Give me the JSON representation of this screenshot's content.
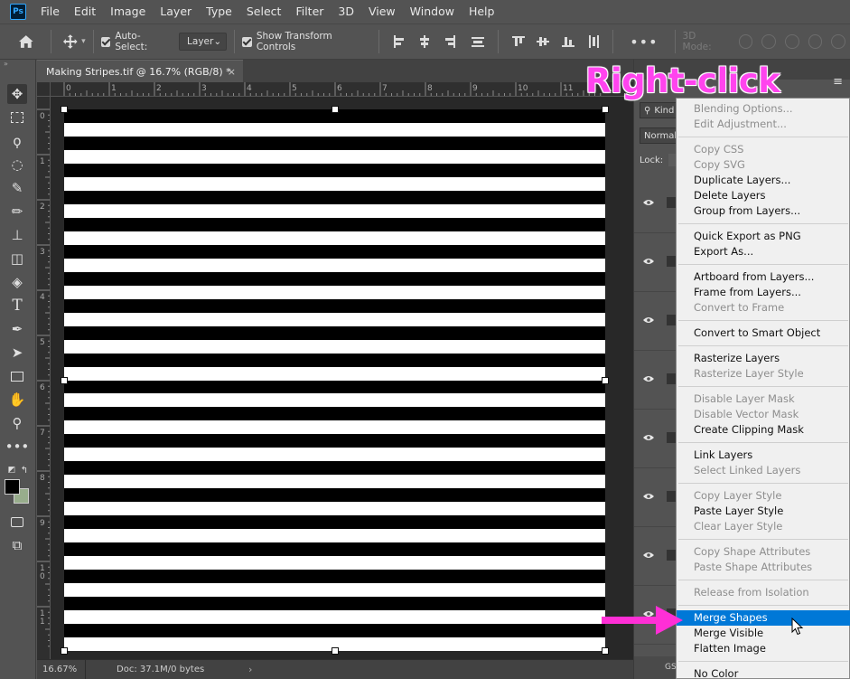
{
  "app": {
    "logo": "Ps"
  },
  "menubar": [
    "File",
    "Edit",
    "Image",
    "Layer",
    "Type",
    "Select",
    "Filter",
    "3D",
    "View",
    "Window",
    "Help"
  ],
  "options": {
    "auto_select_label": "Auto-Select:",
    "auto_select_value": "Layer",
    "show_transform_label": "Show Transform Controls",
    "more_label": "•••",
    "mode_3d_label": "3D Mode:"
  },
  "document": {
    "tab_title": "Making Stripes.tif @ 16.7% (RGB/8) *",
    "close_glyph": "×",
    "stripes": 20,
    "stripe_dark": "#000000",
    "stripe_light": "#ffffff"
  },
  "rulers": {
    "top": [
      "0",
      "1",
      "2",
      "3",
      "4",
      "5",
      "6",
      "7",
      "8",
      "9",
      "10",
      "11"
    ],
    "left": [
      "0",
      "1",
      "2",
      "3",
      "4",
      "5",
      "6",
      "7",
      "8",
      "9",
      "10",
      "11"
    ]
  },
  "status": {
    "zoom": "16.67%",
    "doc_info": "Doc: 37.1M/0 bytes",
    "caret": "›"
  },
  "colors": {
    "foreground": "#000000",
    "background": "#98ad8c",
    "highlight": "#0078d7",
    "annotation": "#ff44ee"
  },
  "panel": {
    "kind_label": "Kind",
    "blend_mode": "Normal",
    "lock_label": "Lock:",
    "menu_glyph": "≡",
    "bottom_text": "GS"
  },
  "context_menu": {
    "groups": [
      [
        {
          "label": "Blending Options...",
          "disabled": true
        },
        {
          "label": "Edit Adjustment...",
          "disabled": true
        }
      ],
      [
        {
          "label": "Copy CSS",
          "disabled": true
        },
        {
          "label": "Copy SVG",
          "disabled": true
        },
        {
          "label": "Duplicate Layers...",
          "disabled": false
        },
        {
          "label": "Delete Layers",
          "disabled": false
        },
        {
          "label": "Group from Layers...",
          "disabled": false
        }
      ],
      [
        {
          "label": "Quick Export as PNG",
          "disabled": false
        },
        {
          "label": "Export As...",
          "disabled": false
        }
      ],
      [
        {
          "label": "Artboard from Layers...",
          "disabled": false
        },
        {
          "label": "Frame from Layers...",
          "disabled": false
        },
        {
          "label": "Convert to Frame",
          "disabled": true
        }
      ],
      [
        {
          "label": "Convert to Smart Object",
          "disabled": false
        }
      ],
      [
        {
          "label": "Rasterize Layers",
          "disabled": false
        },
        {
          "label": "Rasterize Layer Style",
          "disabled": true
        }
      ],
      [
        {
          "label": "Disable Layer Mask",
          "disabled": true
        },
        {
          "label": "Disable Vector Mask",
          "disabled": true
        },
        {
          "label": "Create Clipping Mask",
          "disabled": false
        }
      ],
      [
        {
          "label": "Link Layers",
          "disabled": false
        },
        {
          "label": "Select Linked Layers",
          "disabled": true
        }
      ],
      [
        {
          "label": "Copy Layer Style",
          "disabled": true
        },
        {
          "label": "Paste Layer Style",
          "disabled": false
        },
        {
          "label": "Clear Layer Style",
          "disabled": true
        }
      ],
      [
        {
          "label": "Copy Shape Attributes",
          "disabled": true
        },
        {
          "label": "Paste Shape Attributes",
          "disabled": true
        }
      ],
      [
        {
          "label": "Release from Isolation",
          "disabled": true
        }
      ],
      [
        {
          "label": "Merge Shapes",
          "disabled": false,
          "highlighted": true
        },
        {
          "label": "Merge Visible",
          "disabled": false
        },
        {
          "label": "Flatten Image",
          "disabled": false
        }
      ],
      [
        {
          "label": "No Color",
          "disabled": false
        }
      ]
    ]
  },
  "annotation": {
    "text": "Right-click"
  }
}
